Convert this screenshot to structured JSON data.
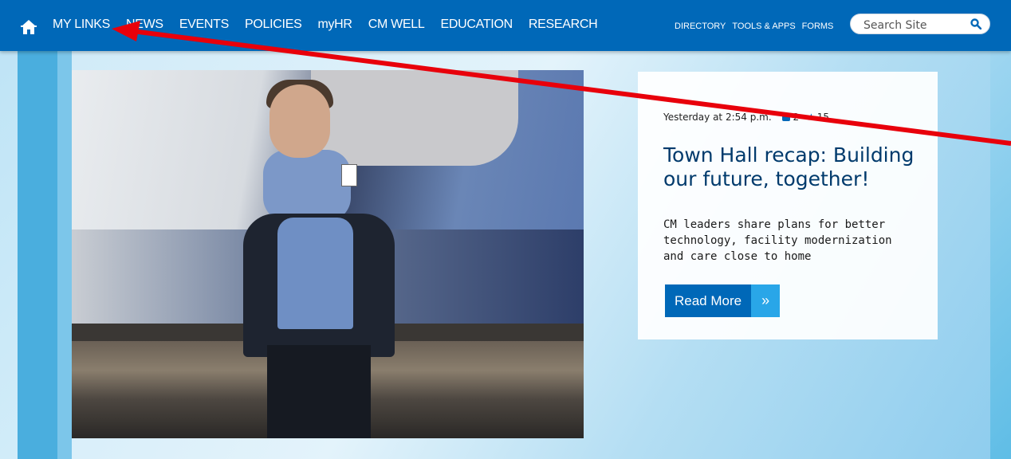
{
  "nav": {
    "left_items": [
      {
        "label": "MY LINKS"
      },
      {
        "label": "NEWS"
      },
      {
        "label": "EVENTS"
      },
      {
        "label": "POLICIES"
      },
      {
        "label": "myHR"
      },
      {
        "label": "CM WELL"
      },
      {
        "label": "EDUCATION"
      },
      {
        "label": "RESEARCH"
      }
    ],
    "right_items": [
      {
        "label": "DIRECTORY"
      },
      {
        "label": "TOOLS & APPS"
      },
      {
        "label": "FORMS"
      }
    ],
    "search_placeholder": "Search Site",
    "home_icon": "home-icon",
    "search_icon": "magnifier-icon"
  },
  "feature": {
    "timestamp": "Yesterday at 2:54 p.m.",
    "comments": "2",
    "stars": "15",
    "title": "Town Hall recap: Building our future, together!",
    "description": "CM leaders share plans for better technology, facility modernization and care close to home",
    "button_label": "Read More",
    "button_icon": "double-chevron-right-icon"
  },
  "colors": {
    "nav_bg": "#0068b8",
    "accent": "#29a6e8",
    "annotation": "#e8000b"
  }
}
